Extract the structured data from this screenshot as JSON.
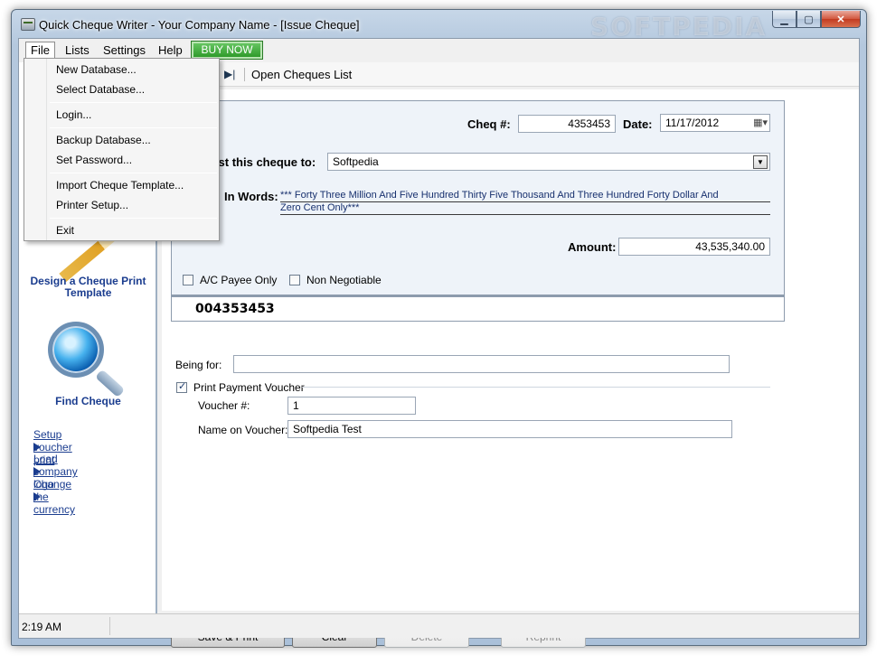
{
  "window": {
    "title": "Quick Cheque Writer - Your Company Name - [Issue Cheque]",
    "watermark": "SOFTPEDIA",
    "controls": {
      "minimize": "▁",
      "maximize": "▢",
      "close": "✕"
    }
  },
  "menubar": {
    "items": [
      "File",
      "Lists",
      "Settings",
      "Help"
    ],
    "buy_now": "BUY NOW"
  },
  "file_menu": {
    "items": [
      "New Database...",
      "Select Database...",
      "Login...",
      "Backup Database...",
      "Set Password...",
      "Import Cheque Template...",
      "Printer Setup...",
      "Exit"
    ]
  },
  "toolbar": {
    "next_icon": "▶|",
    "open_list": "Open Cheques List"
  },
  "sidebar": {
    "design_caption": "Design a Cheque Print Template",
    "find_caption": "Find Cheque",
    "links": [
      "Setup voucher print",
      "Load company logo",
      "Change the currency"
    ]
  },
  "cheque": {
    "cheq_no_label": "Cheq #:",
    "cheq_no": "4353453",
    "date_label": "Date:",
    "date": "11/17/2012",
    "payee_label": "inst this cheque to:",
    "payee": "Softpedia",
    "words_label": "In Words:",
    "words_line1": "*** Forty  Three Million And Five Hundred Thirty  Five Thousand And Three Hundred Forty  Dollar And",
    "words_line2": "Zero Cent Only***",
    "amount_label": "Amount:",
    "amount": "43,535,340.00",
    "ac_payee": "A/C Payee Only",
    "non_negotiable": "Non Negotiable",
    "micr": "004353453"
  },
  "form": {
    "being_for_label": "Being for:",
    "being_for": "",
    "print_voucher": "Print Payment Voucher",
    "print_voucher_checked": true,
    "voucher_no_label": "Voucher #:",
    "voucher_no": "1",
    "name_on_voucher_label": "Name on Voucher:",
    "name_on_voucher": "Softpedia Test"
  },
  "buttons": {
    "save_print": "Save & Print",
    "clear": "Clear",
    "delete": "Delete",
    "reprint": "Reprint"
  },
  "status": {
    "time": "2:19 AM"
  }
}
